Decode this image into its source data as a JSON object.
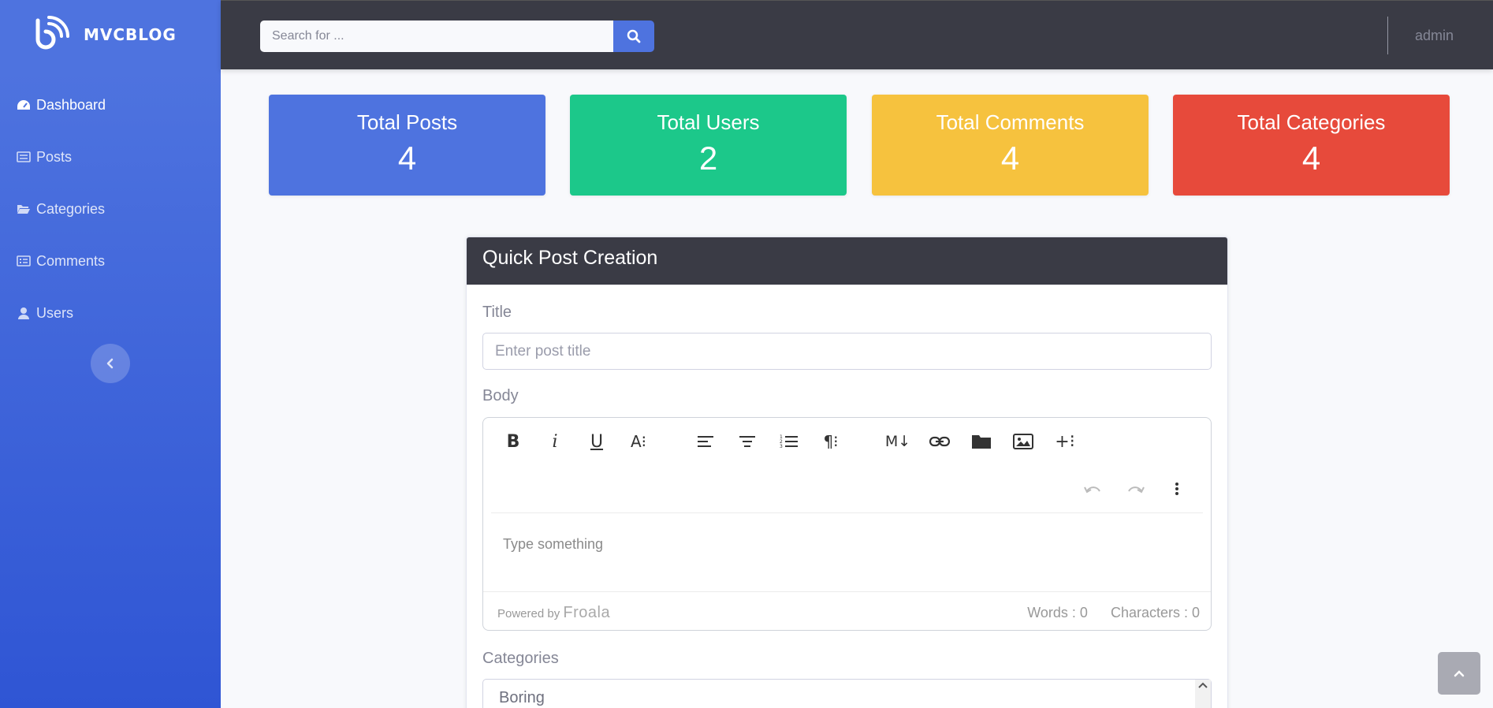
{
  "brand": {
    "name": "MVCBLOG"
  },
  "sidebar": {
    "items": [
      {
        "label": "Dashboard",
        "icon": "tachometer-icon",
        "active": true
      },
      {
        "label": "Posts",
        "icon": "newspaper-icon"
      },
      {
        "label": "Categories",
        "icon": "folder-open-icon"
      },
      {
        "label": "Comments",
        "icon": "list-alt-icon"
      },
      {
        "label": "Users",
        "icon": "user-icon"
      }
    ],
    "toggle_icon": "chevron-left-icon"
  },
  "topbar": {
    "search": {
      "placeholder": "Search for ...",
      "value": ""
    },
    "user": "admin"
  },
  "stats": [
    {
      "title": "Total Posts",
      "value": "4",
      "color": "#4e73df"
    },
    {
      "title": "Total Users",
      "value": "2",
      "color": "#1cc88a"
    },
    {
      "title": "Total Comments",
      "value": "4",
      "color": "#f6c23e"
    },
    {
      "title": "Total Categories",
      "value": "4",
      "color": "#e74a3b"
    }
  ],
  "quick_post": {
    "header": "Quick Post Creation",
    "title_label": "Title",
    "title_placeholder": "Enter post title",
    "body_label": "Body",
    "editor": {
      "placeholder": "Type something",
      "powered_by": "Powered by",
      "brand": "Froala",
      "words": "Words : 0",
      "characters": "Characters : 0"
    },
    "categories_label": "Categories",
    "categories_options": [
      "Boring"
    ]
  }
}
